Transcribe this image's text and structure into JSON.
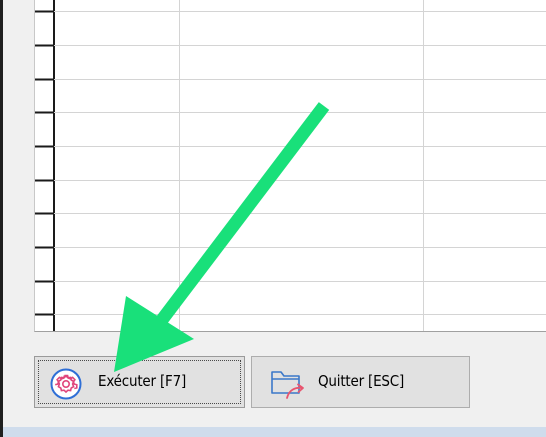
{
  "buttons": {
    "run": {
      "label": "Exécuter [F7]",
      "icon": "gear-icon"
    },
    "quit": {
      "label": "Quitter [ESC]",
      "icon": "folder-exit-icon"
    }
  },
  "grid": {
    "visible_rows": 9,
    "visible_columns": 3
  },
  "colors": {
    "annotation_arrow": "#19e07a",
    "gear_icon": "#e0467c",
    "icon_ring": "#2f6fd6",
    "folder_icon": "#3b78c9",
    "exit_arrow": "#e8556f",
    "button_face": "#e1e1e1",
    "window_bg": "#f0f0f0"
  }
}
